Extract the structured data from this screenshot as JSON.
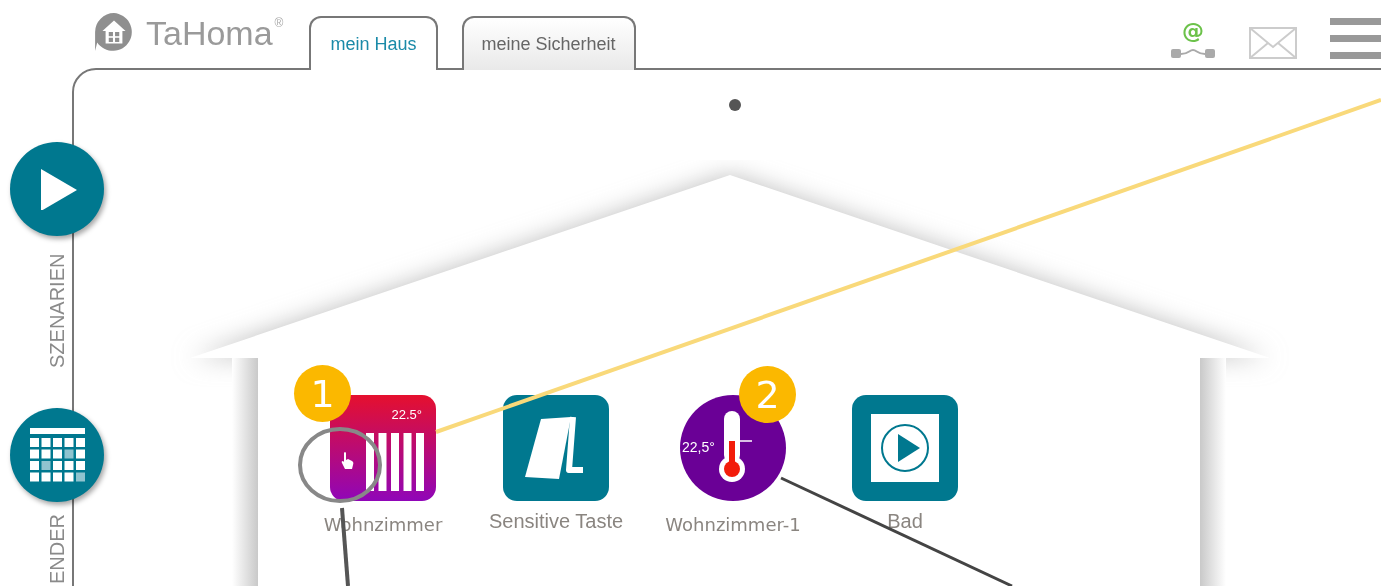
{
  "brand": {
    "name": "TaHoma",
    "mark": "®"
  },
  "connection": {
    "symbol": "@"
  },
  "tabs": [
    {
      "label": "mein Haus",
      "selected": true
    },
    {
      "label": "meine Sicherheit",
      "selected": false
    }
  ],
  "side_menu": [
    {
      "kind": "play",
      "label": "SZENARIEN"
    },
    {
      "kind": "calendar",
      "label": "ENDER"
    }
  ],
  "devices": [
    {
      "kind": "heater",
      "name": "Wohnzimmer",
      "reading": "22.5°"
    },
    {
      "kind": "switch",
      "name": "Sensitive Taste"
    },
    {
      "kind": "thermometer",
      "name": "Wohnzimmer-1",
      "reading": "22,5°"
    },
    {
      "kind": "scene",
      "name": "Bad"
    }
  ],
  "callouts": [
    {
      "label": "1"
    },
    {
      "label": "2"
    }
  ]
}
